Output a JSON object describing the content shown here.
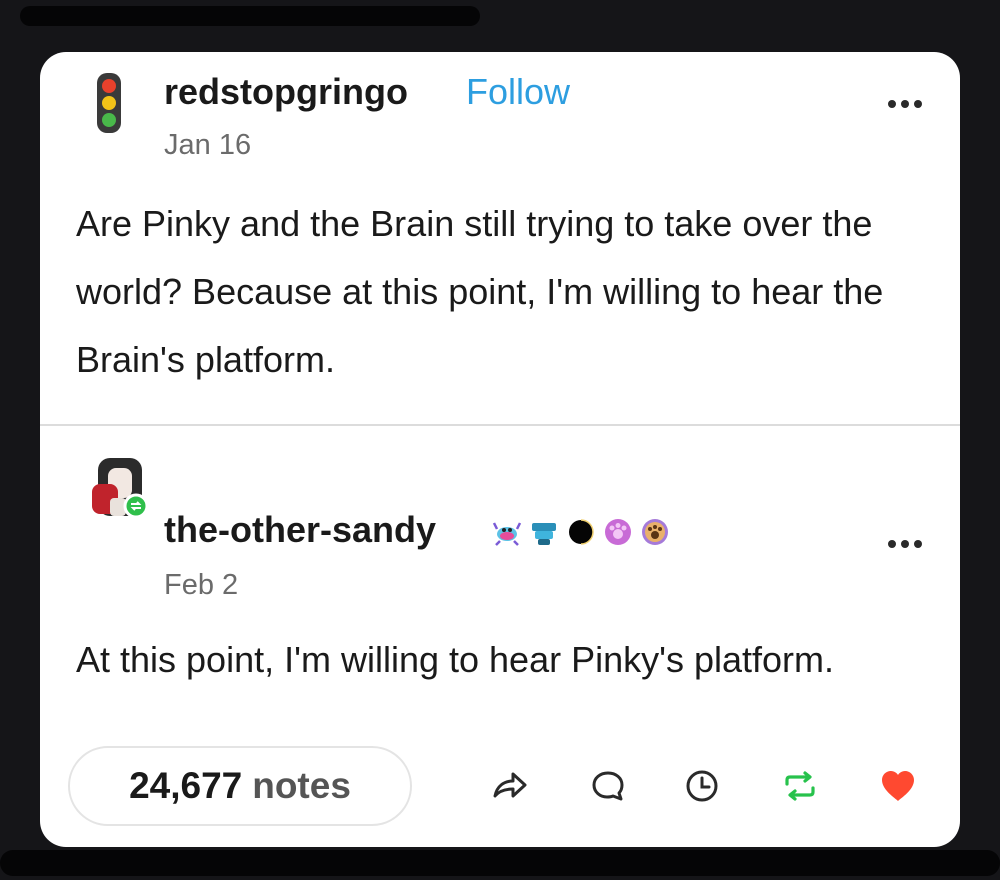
{
  "post1": {
    "username": "redstopgringo",
    "follow_label": "Follow",
    "date": "Jan 16",
    "text": "Are Pinky and the Brain still trying to take over the world? Because at this point, I'm willing to hear the Brain's platform."
  },
  "post2": {
    "username": "the-other-sandy",
    "date": "Feb 2",
    "text": "At this point, I'm willing to hear Pinky's platform.",
    "badges": [
      "crab-badge-icon",
      "teal-badge-icon",
      "black-circle-badge-icon",
      "purple-paw-badge-icon",
      "brown-paw-badge-icon"
    ]
  },
  "footer": {
    "notes_count": "24,677",
    "notes_label": "notes",
    "actions": [
      "share-icon",
      "reply-icon",
      "schedule-icon",
      "reblog-icon",
      "like-icon"
    ]
  },
  "colors": {
    "follow": "#2d9ee0",
    "reblog": "#27c24c",
    "like": "#ff4930",
    "background": "#151518",
    "card": "#ffffff"
  }
}
